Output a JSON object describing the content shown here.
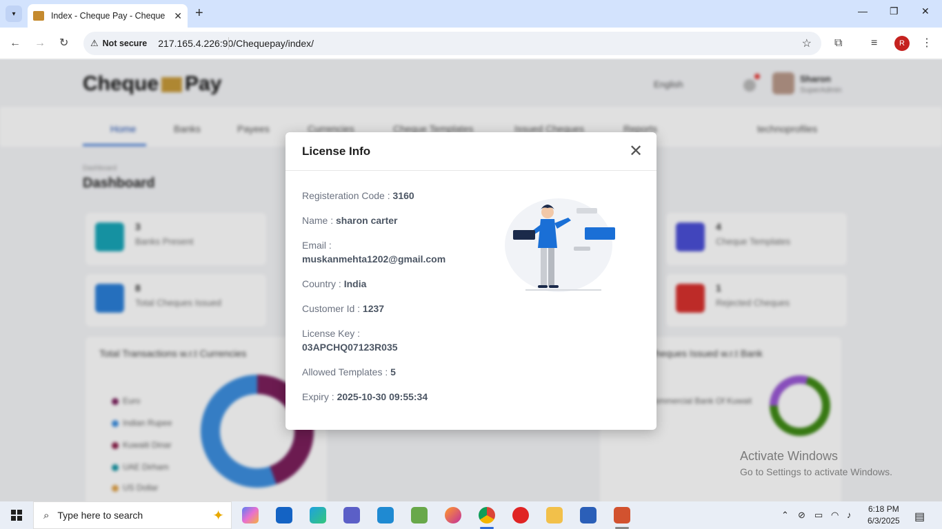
{
  "browser": {
    "tab_title": "Index - Cheque Pay - Cheque Pay",
    "url": "217.165.4.226:90/Chequepay/index/",
    "security_label": "Not secure",
    "profile_initial": "R"
  },
  "app": {
    "logo_left": "Cheque",
    "logo_right": "Pay",
    "language": "English",
    "user_name": "Sharon",
    "user_role": "SuperAdmin",
    "nav": [
      "Home",
      "Banks",
      "Payees",
      "Currencies",
      "Cheque Templates",
      "Issued Cheques",
      "Reports"
    ],
    "nav_right": "technoprofiles",
    "breadcrumb": "Dashboard",
    "page_title": "Dashboard",
    "stats": [
      {
        "num": "3",
        "label": "Banks Present"
      },
      {
        "num": "4",
        "label": "Cheque Templates"
      },
      {
        "num": "8",
        "label": "Total Cheques Issued"
      },
      {
        "num": "1",
        "label": "Rejected Cheques"
      }
    ],
    "panel_left_title": "Total Transactions w.r.t Currencies",
    "panel_right_title": "Cheques Issued w.r.t Bank",
    "legend_left": [
      "Euro",
      "Indian Rupee",
      "Kuwaiti Dinar",
      "UAE Dirham",
      "US Dollar"
    ],
    "legend_right": [
      "Commercial Bank Of Kuwait"
    ]
  },
  "modal": {
    "title": "License Info",
    "fields": [
      {
        "label": "Registeration Code :",
        "value": "3160"
      },
      {
        "label": "Name :",
        "value": "sharon carter"
      },
      {
        "label": "Email :",
        "value": "muskanmehta1202@gmail.com"
      },
      {
        "label": "Country :",
        "value": "India"
      },
      {
        "label": "Customer Id :",
        "value": "1237"
      },
      {
        "label": "License Key :",
        "value": "03APCHQ07123R035"
      },
      {
        "label": "Allowed Templates :",
        "value": "5"
      },
      {
        "label": "Expiry :",
        "value": "2025-10-30 09:55:34"
      }
    ]
  },
  "watermark": {
    "line1": "Activate Windows",
    "line2": "Go to Settings to activate Windows."
  },
  "taskbar": {
    "search_placeholder": "Type here to search",
    "time": "6:18 PM",
    "date": "6/3/2025"
  },
  "colors": {
    "accent": "#1a6fd6",
    "modal_bg": "#ffffff",
    "chart_purple": "#7b1f5c",
    "chart_blue": "#3d8fe0",
    "chart_green": "#3f8a16",
    "chart_violet": "#9b59d6"
  }
}
